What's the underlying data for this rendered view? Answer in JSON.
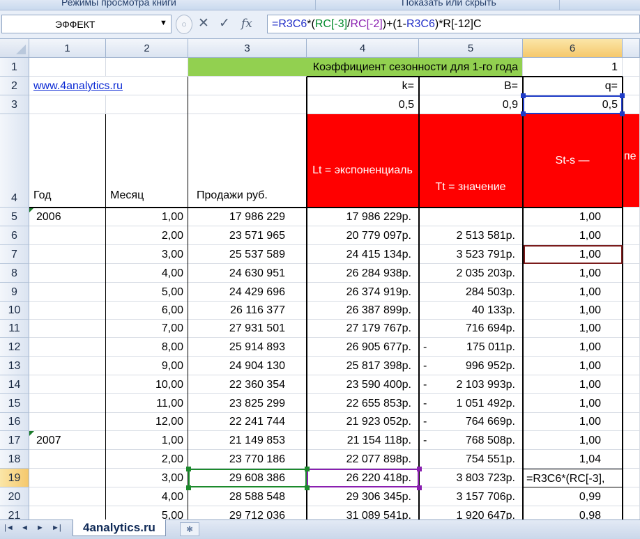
{
  "ribbon": {
    "left_label": "Режимы просмотра книги",
    "right_label": "Показать или скрыть"
  },
  "namebox": {
    "value": "ЭФФЕКТ"
  },
  "formula_bar": {
    "parts": [
      {
        "t": "=R3C6",
        "c": "blue"
      },
      {
        "t": "*(",
        "c": "def"
      },
      {
        "t": "RC[-3]",
        "c": "green"
      },
      {
        "t": "/",
        "c": "def"
      },
      {
        "t": "RC[-2]",
        "c": "purple"
      },
      {
        "t": ")+(1-",
        "c": "def"
      },
      {
        "t": "R3C6",
        "c": "blue"
      },
      {
        "t": ")*R[-12]C",
        "c": "def"
      }
    ]
  },
  "columns": [
    "1",
    "2",
    "3",
    "4",
    "5",
    "6"
  ],
  "rows_labels": [
    "1",
    "2",
    "3",
    "4",
    "5",
    "6",
    "7",
    "8",
    "9",
    "10",
    "11",
    "12",
    "13",
    "14",
    "15",
    "16",
    "17",
    "18",
    "19",
    "20",
    "21"
  ],
  "top": {
    "title": "Коэффициент сезонности для 1-го года",
    "title_value": "1",
    "link": "www.4analytics.ru",
    "k_label": "k=",
    "b_label": "B=",
    "q_label": "q=",
    "k_value": "0,5",
    "b_value": "0,9",
    "q_value": "0,5"
  },
  "headers": {
    "year": "Год",
    "month": "Месяц",
    "sales": "Продажи руб.",
    "lt": "Lt = экспоненциаль но сглаженный ряд",
    "tt": "Tt = значение тренда",
    "st": "St-s — коэффициент сезонности предыдущег о периода;",
    "next_partial": "пе"
  },
  "table": [
    {
      "year": "2006",
      "month": "1,00",
      "sales": "17 986 229",
      "lt": "17 986 229р.",
      "tt": "",
      "st": "1,00"
    },
    {
      "year": "",
      "month": "2,00",
      "sales": "23 571 965",
      "lt": "20 779 097р.",
      "tt": "2 513 581р.",
      "st": "1,00"
    },
    {
      "year": "",
      "month": "3,00",
      "sales": "25 537 589",
      "lt": "24 415 134р.",
      "tt": "3 523 791р.",
      "st": "1,00"
    },
    {
      "year": "",
      "month": "4,00",
      "sales": "24 630 951",
      "lt": "26 284 938р.",
      "tt": "2 035 203р.",
      "st": "1,00"
    },
    {
      "year": "",
      "month": "5,00",
      "sales": "24 429 696",
      "lt": "26 374 919р.",
      "tt": "284 503р.",
      "st": "1,00"
    },
    {
      "year": "",
      "month": "6,00",
      "sales": "26 116 377",
      "lt": "26 387 899р.",
      "tt": "40 133р.",
      "st": "1,00"
    },
    {
      "year": "",
      "month": "7,00",
      "sales": "27 931 501",
      "lt": "27 179 767р.",
      "tt": "716 694р.",
      "st": "1,00"
    },
    {
      "year": "",
      "month": "8,00",
      "sales": "25 914 893",
      "lt": "26 905 677р.",
      "tt": "175 011р.",
      "tt_neg": "-",
      "st": "1,00"
    },
    {
      "year": "",
      "month": "9,00",
      "sales": "24 904 130",
      "lt": "25 817 398р.",
      "tt": "996 952р.",
      "tt_neg": "-",
      "st": "1,00"
    },
    {
      "year": "",
      "month": "10,00",
      "sales": "22 360 354",
      "lt": "23 590 400р.",
      "tt": "2 103 993р.",
      "tt_neg": "-",
      "st": "1,00"
    },
    {
      "year": "",
      "month": "11,00",
      "sales": "23 825 299",
      "lt": "22 655 853р.",
      "tt": "1 051 492р.",
      "tt_neg": "-",
      "st": "1,00"
    },
    {
      "year": "",
      "month": "12,00",
      "sales": "22 241 744",
      "lt": "21 923 052р.",
      "tt": "764 669р.",
      "tt_neg": "-",
      "st": "1,00"
    },
    {
      "year": "2007",
      "month": "1,00",
      "sales": "21 149 853",
      "lt": "21 154 118р.",
      "tt": "768 508р.",
      "tt_neg": "-",
      "st": "1,00"
    },
    {
      "year": "",
      "month": "2,00",
      "sales": "23 770 186",
      "lt": "22 077 898р.",
      "tt": "754 551р.",
      "st": "1,04"
    },
    {
      "year": "",
      "month": "3,00",
      "sales": "29 608 386",
      "lt": "26 220 418р.",
      "tt": "3 803 723р.",
      "st": "=R3C6*(RC[-3],"
    },
    {
      "year": "",
      "month": "4,00",
      "sales": "28 588 548",
      "lt": "29 306 345р.",
      "tt": "3 157 706р.",
      "st": "0,99"
    },
    {
      "year": "",
      "month": "5,00",
      "sales": "29 712 036",
      "lt": "31 089 541р.",
      "tt": "1 920 647р.",
      "st": "0,98"
    }
  ],
  "sheet_tab": "4analytics.ru",
  "tab_nav": [
    "|◄",
    "◄",
    "►",
    "►|"
  ]
}
